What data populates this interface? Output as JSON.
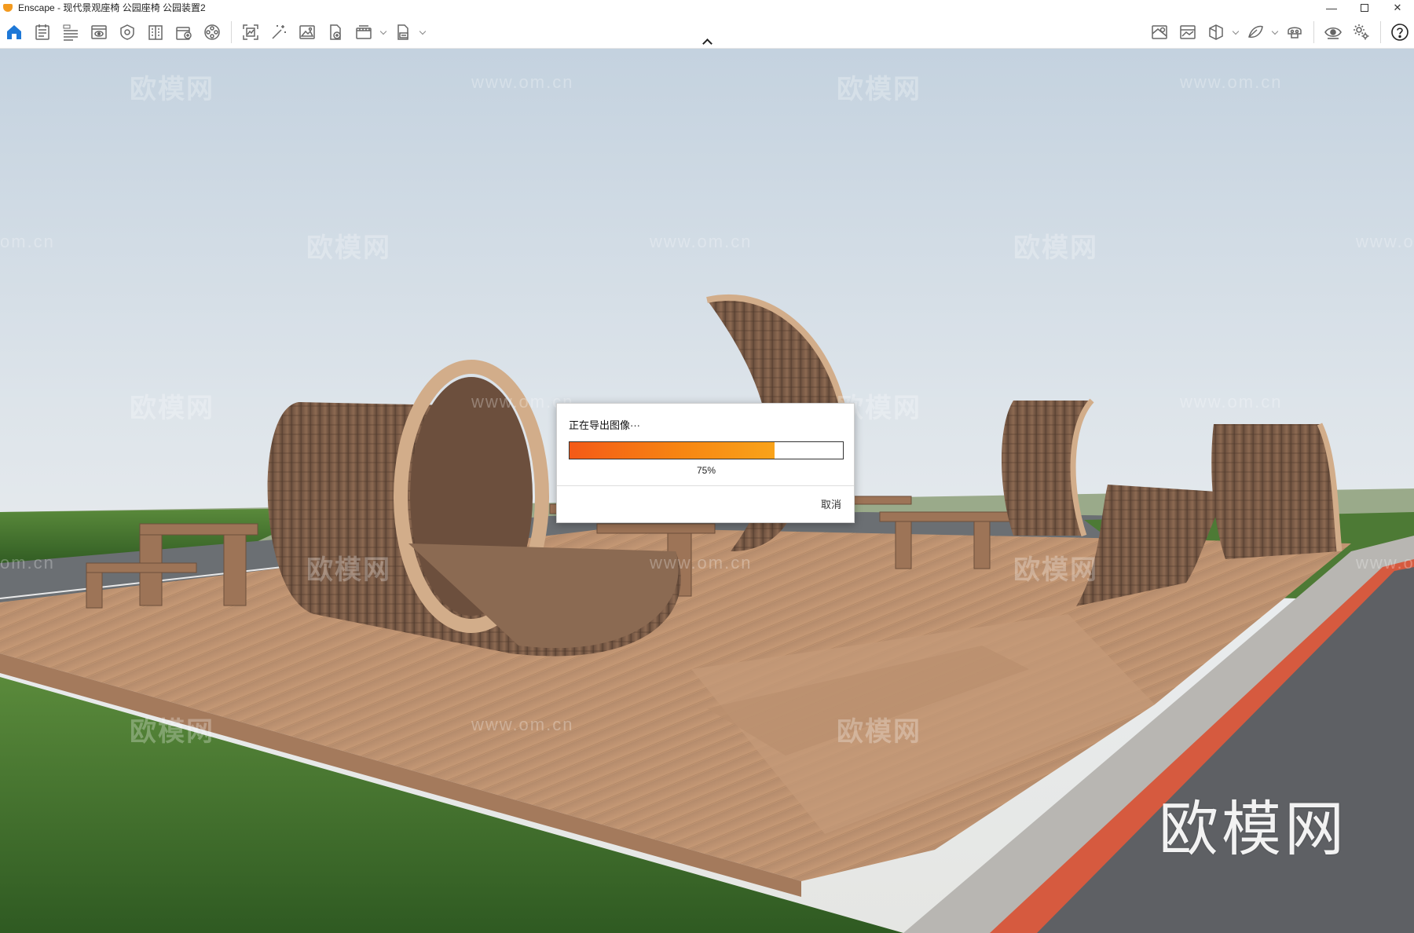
{
  "window": {
    "title": "Enscape - 现代景观座椅 公园座椅 公园装置2",
    "controls": {
      "minimize": "—",
      "close": "✕"
    }
  },
  "toolbar": {
    "left_tools": [
      {
        "name": "home-icon"
      },
      {
        "name": "notes-icon"
      },
      {
        "name": "bim-icon"
      },
      {
        "name": "view-icon"
      },
      {
        "name": "light-icon"
      },
      {
        "name": "building-icon"
      },
      {
        "name": "asset-library-icon"
      },
      {
        "name": "video-editor-icon"
      },
      {
        "name": "screenshot-icon"
      },
      {
        "name": "magic-wand-icon"
      },
      {
        "name": "image-icon"
      },
      {
        "name": "file-export-icon"
      },
      {
        "name": "batch-render-icon"
      },
      {
        "name": "exe-export-icon"
      }
    ],
    "right_tools": [
      {
        "name": "map-icon"
      },
      {
        "name": "panorama-icon"
      },
      {
        "name": "cube-view-icon"
      },
      {
        "name": "material-icon"
      },
      {
        "name": "vr-headset-icon"
      },
      {
        "name": "visual-settings-icon"
      },
      {
        "name": "settings-icon"
      },
      {
        "name": "help-icon"
      }
    ]
  },
  "colors": {
    "accent": "#1e78d7",
    "progress_start": "#f45a17",
    "progress_end": "#f9a31a"
  },
  "watermarks": {
    "brand": "欧模网",
    "url": "www.om.cn",
    "url_partial_left": "om.cn",
    "url_partial_right": "www.o"
  },
  "dialog": {
    "message": "正在导出图像···",
    "progress_value": 0.75,
    "progress_label": "75%",
    "cancel_label": "取消"
  }
}
